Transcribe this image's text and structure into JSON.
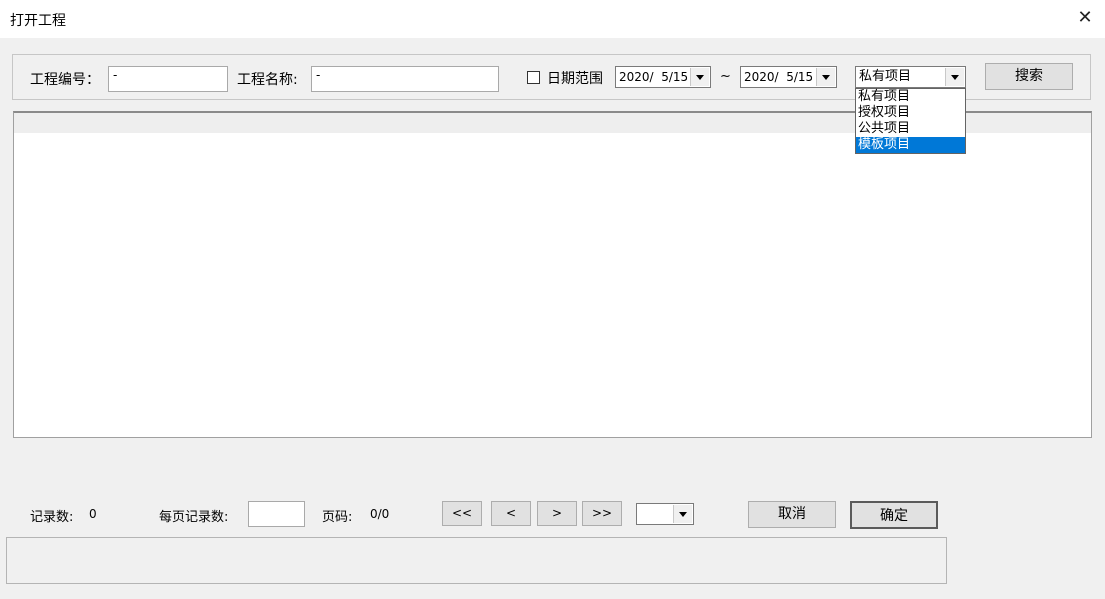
{
  "window": {
    "title": "打开工程",
    "close_glyph": "✕"
  },
  "search": {
    "code_label": "工程编号：",
    "code_value": "-",
    "name_label": "工程名称:",
    "name_value": "-",
    "date_range_label": "日期范围",
    "date_from": "2020/  5/15",
    "tilde": "~",
    "date_to": "2020/  5/15",
    "type_selected": "私有项目",
    "search_button": "搜索"
  },
  "type_options": [
    "私有项目",
    "授权项目",
    "公共项目",
    "模板项目"
  ],
  "type_highlighted": "模板项目",
  "footer": {
    "record_count_label": "记录数:",
    "record_count_value": "0",
    "per_page_label": "每页记录数:",
    "per_page_value": "",
    "page_label": "页码:",
    "page_value": "0/0",
    "first_button": "<<",
    "prev_button": "<",
    "next_button": ">",
    "last_button": ">>",
    "cancel_button": "取消",
    "ok_button": "确定"
  }
}
